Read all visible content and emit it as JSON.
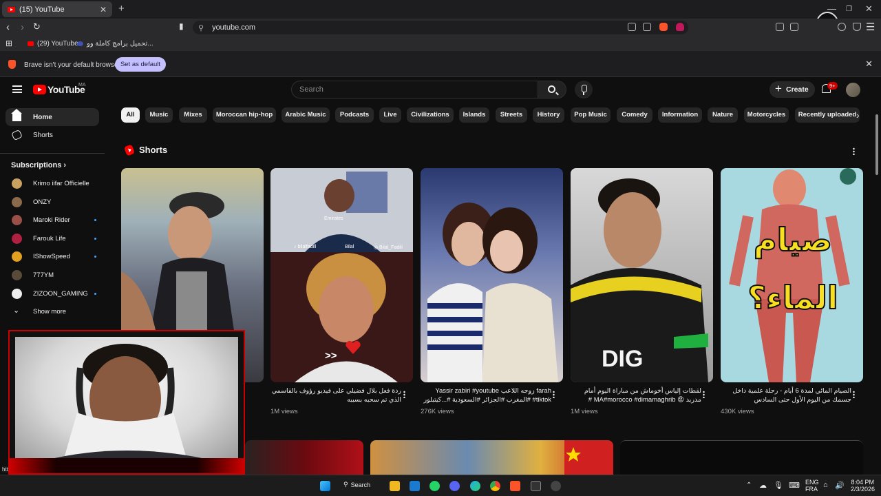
{
  "browser": {
    "tab_title": "(15) YouTube",
    "tab_close": "✕",
    "new_tab": "+",
    "url": "youtube.com",
    "bookmarks": [
      {
        "label": "(29) YouTube"
      },
      {
        "label": "تحميل برامج كاملة وو..."
      }
    ],
    "notice_text": "Brave isn't your default browser",
    "notice_button": "Set as default",
    "notice_close": "✕"
  },
  "youtube": {
    "logo": "YouTube",
    "country": "MA",
    "search_placeholder": "Search",
    "create": "Create",
    "notifications": "9+",
    "sidebar": {
      "home": "Home",
      "shorts": "Shorts",
      "subscriptions_title": "Subscriptions ›",
      "subs": [
        {
          "name": "Krimo iifar Officielle"
        },
        {
          "name": "ONZY"
        },
        {
          "name": "Maroki Rider"
        },
        {
          "name": "Farouk Life"
        },
        {
          "name": "IShowSpeed"
        },
        {
          "name": "777YM"
        },
        {
          "name": "ZIZOON_GAMING"
        },
        {
          "name": "Show more"
        }
      ]
    },
    "chips": [
      "All",
      "Music",
      "Mixes",
      "Moroccan hip-hop",
      "Arabic Music",
      "Podcasts",
      "Live",
      "Civilizations",
      "Islands",
      "Streets",
      "History",
      "Pop Music",
      "Comedy",
      "Information",
      "Nature",
      "Motorcycles",
      "Recently uploaded"
    ],
    "shorts_title": "Shorts",
    "shorts": [
      {
        "title": "",
        "views": ""
      },
      {
        "title": "ردة فعل بلال فضيلي على فيديو رؤوف بالقاسمي الذي تم سحبه بسببه",
        "views": "1M views"
      },
      {
        "title": "farah زوجه اللاعب Yassir zabiri #youtube #tiktok #المغرب #الجزائر #السعودية #...كيتبلور",
        "views": "276K views"
      },
      {
        "title": "لقطات إلياس أخوماش من مباراة اليوم أمام مدريد 😡 MA#morocco #dimamaghrib # المغرب...",
        "views": "1M views"
      },
      {
        "title": "الصيام المائي لمدة 6 أيام - رحلة علمية داخل جسمك من اليوم الأول حتى السادس",
        "views": "430K views"
      }
    ],
    "short_overlay": {
      "handle_left": "♪ bilalfadill",
      "handle_mid": "Bilal",
      "handle_right": "◎ Bilal_Fadili",
      "arrows": ">>",
      "arabic_title": "صيام الماء؟",
      "jersey": "Emirates",
      "sponsor": "DIG"
    }
  },
  "taskbar": {
    "search": "Search",
    "lang": "ENG",
    "lang2": "FRA",
    "time": "8:04 PM",
    "date": "2/3/2026",
    "status_url": "htt"
  }
}
